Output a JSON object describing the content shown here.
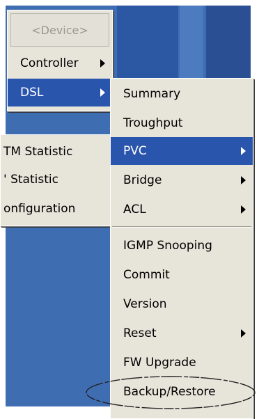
{
  "device_menu": {
    "device_label": "<Device>",
    "items": [
      {
        "label": "Controller",
        "has_submenu": true
      },
      {
        "label": "DSL",
        "has_submenu": true,
        "selected": true
      }
    ]
  },
  "side_menu": {
    "items": [
      {
        "label": "TM Statistic"
      },
      {
        "label": "' Statistic"
      },
      {
        "label": "onfiguration"
      }
    ]
  },
  "dsl_menu": {
    "items": [
      {
        "label": "Summary"
      },
      {
        "label": "Troughput"
      },
      {
        "label": "PVC",
        "has_submenu": true,
        "selected": true
      },
      {
        "label": "Bridge",
        "has_submenu": true
      },
      {
        "label": "ACL",
        "has_submenu": true
      },
      {
        "label": "IGMP Snooping"
      },
      {
        "label": "Commit"
      },
      {
        "label": "Version"
      },
      {
        "label": "Reset",
        "has_submenu": true
      },
      {
        "label": "FW Upgrade"
      },
      {
        "label": "Backup/Restore",
        "highlighted_by_annotation": true
      }
    ]
  },
  "colors": {
    "desktop": "#3f6db2",
    "menu_background": "#e7e4da",
    "selection": "#2a55ad",
    "disabled_text": "#9a978f"
  }
}
